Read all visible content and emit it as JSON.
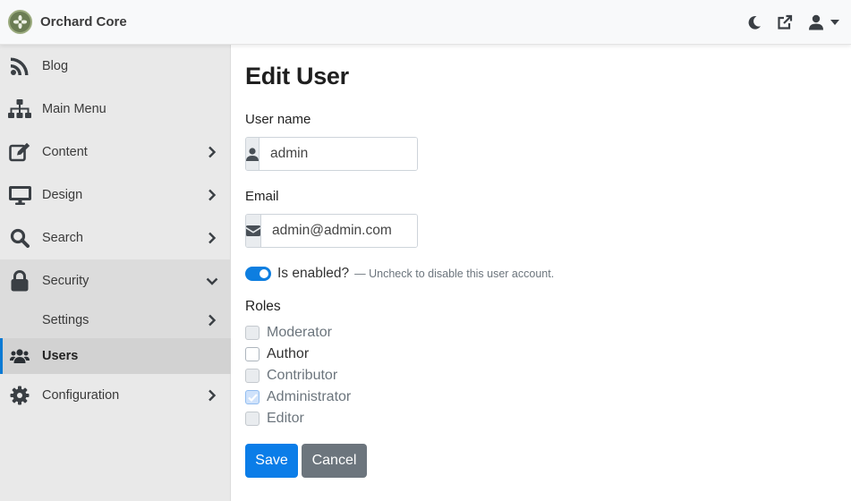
{
  "app": {
    "title": "Orchard Core"
  },
  "topbar": {
    "icons": [
      "moon-icon",
      "external-link-icon",
      "user-icon",
      "caret-down-icon"
    ]
  },
  "sidebar": {
    "items": [
      {
        "label": "Blog",
        "icon": "rss-icon"
      },
      {
        "label": "Main Menu",
        "icon": "sitemap-icon"
      },
      {
        "label": "Content",
        "icon": "edit-icon",
        "chevron": "right"
      },
      {
        "label": "Design",
        "icon": "monitor-icon",
        "chevron": "right"
      },
      {
        "label": "Search",
        "icon": "search-icon",
        "chevron": "right"
      },
      {
        "label": "Security",
        "icon": "lock-icon",
        "chevron": "down",
        "expanded": true
      },
      {
        "label": "Configuration",
        "icon": "gear-icon",
        "chevron": "right"
      }
    ],
    "security_children": [
      {
        "label": "Settings",
        "chevron": "right"
      },
      {
        "label": "Users",
        "icon": "users-icon",
        "active": true
      }
    ]
  },
  "main": {
    "title": "Edit User",
    "username": {
      "label": "User name",
      "value": "admin",
      "icon": "user-icon"
    },
    "email": {
      "label": "Email",
      "value": "admin@admin.com",
      "icon": "envelope-icon"
    },
    "enabled": {
      "label": "Is enabled?",
      "hint": "— Uncheck to disable this user account.",
      "checked": true
    },
    "roles": {
      "title": "Roles",
      "items": [
        {
          "label": "Moderator",
          "checked": false,
          "disabled": true
        },
        {
          "label": "Author",
          "checked": false,
          "disabled": false
        },
        {
          "label": "Contributor",
          "checked": false,
          "disabled": true
        },
        {
          "label": "Administrator",
          "checked": true,
          "disabled": true
        },
        {
          "label": "Editor",
          "checked": false,
          "disabled": true
        }
      ]
    },
    "buttons": {
      "save": "Save",
      "cancel": "Cancel"
    }
  },
  "colors": {
    "accent": "#0b7de8",
    "secondary": "#6c757d",
    "sidebar_bg": "#e9e9e9",
    "active_bar": "#0a7ad4"
  }
}
